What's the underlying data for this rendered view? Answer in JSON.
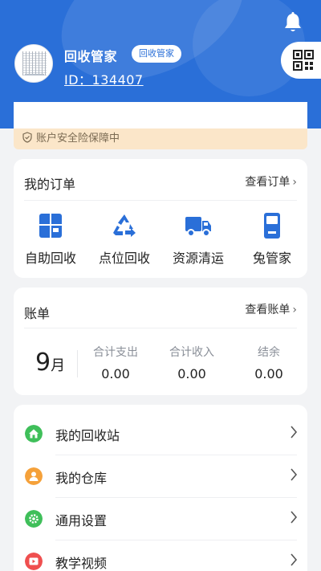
{
  "header": {
    "user_name": "回收管家",
    "role_badge": "回收管家",
    "user_id": "ID：134407",
    "icons": [
      "bell-icon",
      "qr-code-icon"
    ],
    "accent_color": "#2a6fd8"
  },
  "notice": {
    "text": "账户安全险保障中",
    "icon": "shield-check-icon"
  },
  "orders": {
    "title": "我的订单",
    "link": "查看订单",
    "items": [
      {
        "label": "自助回收",
        "icon": "self-recycle-icon"
      },
      {
        "label": "点位回收",
        "icon": "recycle-icon"
      },
      {
        "label": "资源清运",
        "icon": "truck-icon"
      },
      {
        "label": "兔管家",
        "icon": "device-icon"
      }
    ]
  },
  "bill": {
    "title": "账单",
    "link": "查看账单",
    "month_num": "9",
    "month_unit": "月",
    "stats": [
      {
        "label": "合计支出",
        "value": "0.00"
      },
      {
        "label": "合计收入",
        "value": "0.00"
      },
      {
        "label": "结余",
        "value": "0.00"
      }
    ]
  },
  "menu": {
    "items": [
      {
        "label": "我的回收站",
        "icon": "home-icon",
        "color": "#3fbf5a"
      },
      {
        "label": "我的仓库",
        "icon": "person-icon",
        "color": "#f5a13a"
      },
      {
        "label": "通用设置",
        "icon": "gear-icon",
        "color": "#3fbf5a"
      },
      {
        "label": "教学视频",
        "icon": "play-icon",
        "color": "#ef4f4f"
      }
    ]
  }
}
